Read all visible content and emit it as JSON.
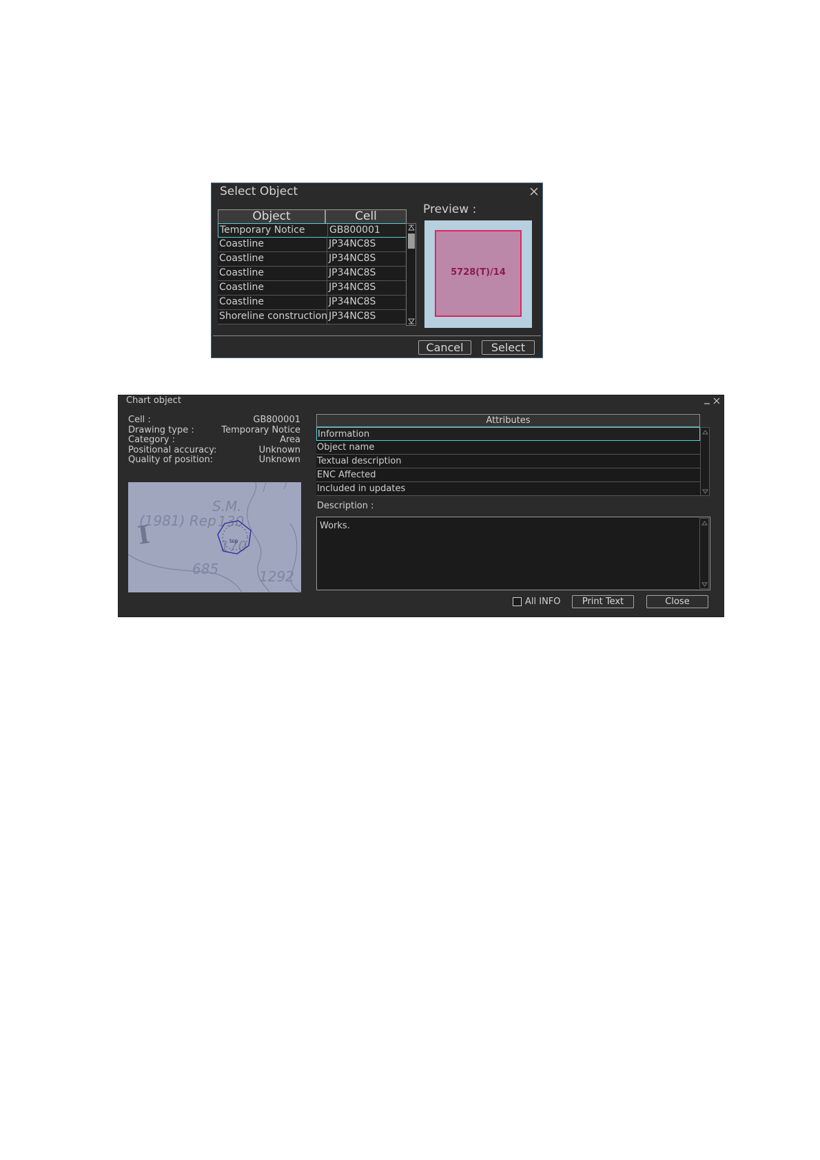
{
  "select_dialog": {
    "title": "Select Object",
    "columns": [
      "Object",
      "Cell"
    ],
    "rows": [
      {
        "object": "Temporary Notice",
        "cell": "GB800001"
      },
      {
        "object": "Coastline",
        "cell": "JP34NC8S"
      },
      {
        "object": "Coastline",
        "cell": "JP34NC8S"
      },
      {
        "object": "Coastline",
        "cell": "JP34NC8S"
      },
      {
        "object": "Coastline",
        "cell": "JP34NC8S"
      },
      {
        "object": "Coastline",
        "cell": "JP34NC8S"
      },
      {
        "object": "Shoreline construction",
        "cell": "JP34NC8S"
      }
    ],
    "preview_label": "Preview :",
    "preview_text": "5728(T)/14",
    "cancel_label": "Cancel",
    "select_label": "Select"
  },
  "chart_object": {
    "title": "Chart object",
    "info": [
      {
        "key": "Cell :",
        "value": "GB800001"
      },
      {
        "key": "Drawing type :",
        "value": "Temporary Notice"
      },
      {
        "key": "Category :",
        "value": "Area"
      },
      {
        "key": "Positional accuracy:",
        "value": "Unknown"
      },
      {
        "key": "Quality of position:",
        "value": "Unknown"
      }
    ],
    "map_labels": {
      "sm": "S.M.",
      "rep": "(1981) Rep",
      "n130": "130",
      "n170": "170",
      "n685": "685",
      "n1292": "1292",
      "symbol": "I",
      "tiny": "tcp"
    },
    "attributes_header": "Attributes",
    "attributes": [
      "Information",
      "Object name",
      "Textual description",
      "ENC Affected",
      "Included in updates"
    ],
    "description_label": "Description :",
    "description_text": "Works.",
    "all_info_label": "All INFO",
    "print_label": "Print Text",
    "close_label": "Close"
  },
  "colors": {
    "dialog_bg": "#2a2a2a",
    "selection": "#4fd1d9",
    "preview_bg": "#b6d0df",
    "preview_fill": "#bb88aa",
    "preview_border": "#e0245e",
    "preview_text": "#8c1a4c",
    "map_bg": "#9fa6bd"
  }
}
